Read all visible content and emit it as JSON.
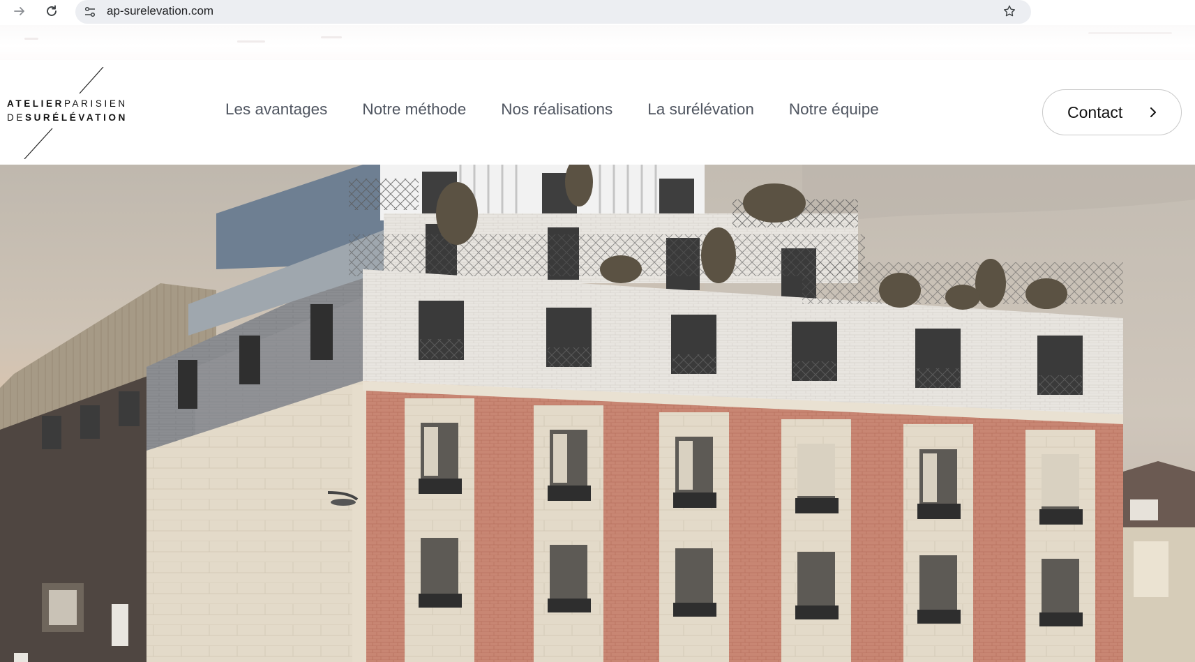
{
  "browser": {
    "url": "ap-surelevation.com",
    "forward_icon": "arrow-forward-icon",
    "reload_icon": "reload-icon",
    "site_info_icon": "site-settings-icon",
    "bookmark_icon": "star-icon"
  },
  "logo": {
    "line1_bold": "ATELIER",
    "line1_thin": "PARISIEN",
    "line2_thin": "DE",
    "line2_bold": "SURÉLÉVATION"
  },
  "nav": {
    "items": [
      {
        "label": "Les avantages"
      },
      {
        "label": "Notre méthode"
      },
      {
        "label": "Nos réalisations"
      },
      {
        "label": "La surélévation"
      },
      {
        "label": "Notre équipe"
      }
    ]
  },
  "contact": {
    "label": "Contact",
    "icon": "chevron-right-icon"
  },
  "colors": {
    "nav_text": "#4f5560",
    "brick": "#c98673",
    "stone": "#e4dccd",
    "addition_white": "#e9e6e2",
    "sky": "#cbc3b8"
  }
}
